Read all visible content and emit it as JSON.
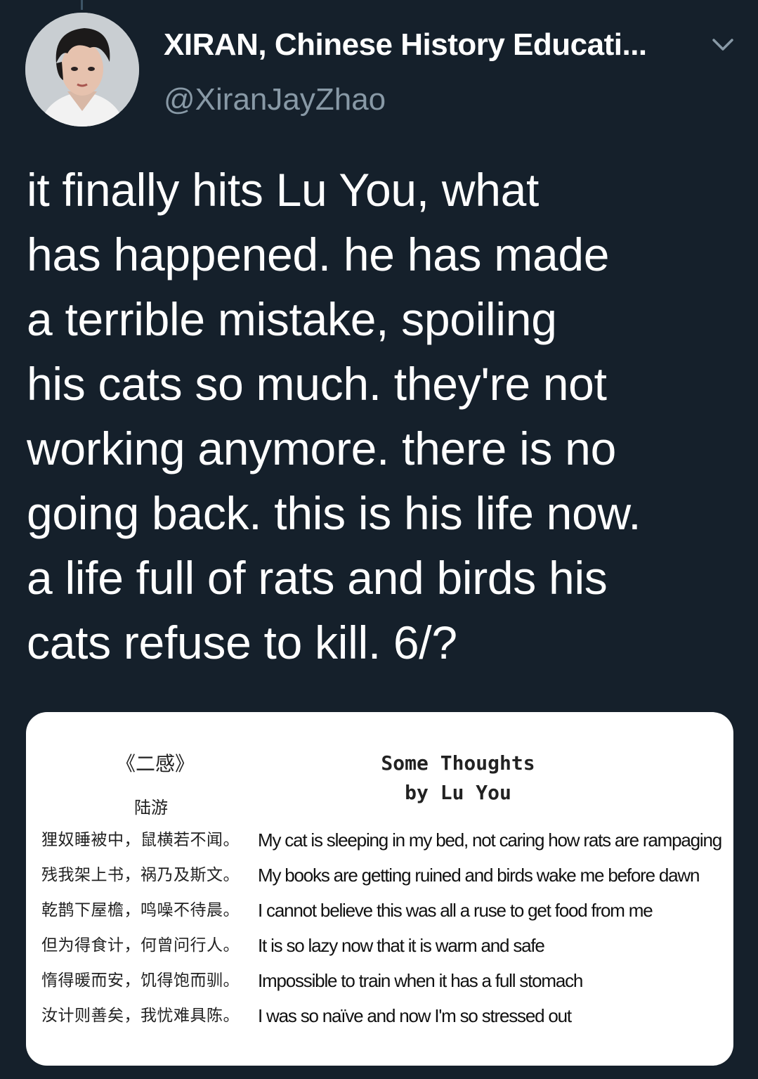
{
  "tweet": {
    "author": {
      "display_name": "XIRAN, Chinese History Educati...",
      "handle": "@XiranJayZhao",
      "avatar_icon": "profile-photo"
    },
    "menu_icon": "chevron-down-icon",
    "text_lines": [
      "it finally hits Lu You, what",
      "has happened. he has made",
      "a terrible mistake, spoiling",
      "his cats so much. they're not",
      "working anymore. there is no",
      "going back. this is his life now.",
      "a life full of rats and birds his",
      "cats refuse to kill. 6/?"
    ]
  },
  "media": {
    "cn_title": "《二感》",
    "cn_author": "陆游",
    "en_title_line1": "Some Thoughts",
    "en_title_line2": "by Lu You",
    "rows": [
      {
        "cn": "狸奴睡被中，鼠横若不闻。",
        "en": "My cat is sleeping in my bed, not caring how rats are rampaging"
      },
      {
        "cn": "残我架上书，祸乃及斯文。",
        "en": "My books are getting ruined and birds wake me before dawn"
      },
      {
        "cn": "乾鹊下屋檐，鸣噪不待晨。",
        "en": "I cannot believe this was all a ruse to get food from me"
      },
      {
        "cn": "但为得食计，何曾问行人。",
        "en": "It is so lazy now that it is warm and safe"
      },
      {
        "cn": "惰得暖而安，饥得饱而驯。",
        "en": "Impossible to train when it has a full stomach"
      },
      {
        "cn": "汝计则善矣，我忧难具陈。",
        "en": "I was so naïve and now I'm so stressed out"
      }
    ]
  },
  "colors": {
    "background": "#15202b",
    "text_primary": "#ffffff",
    "text_secondary": "#8899a6",
    "card_background": "#ffffff"
  }
}
